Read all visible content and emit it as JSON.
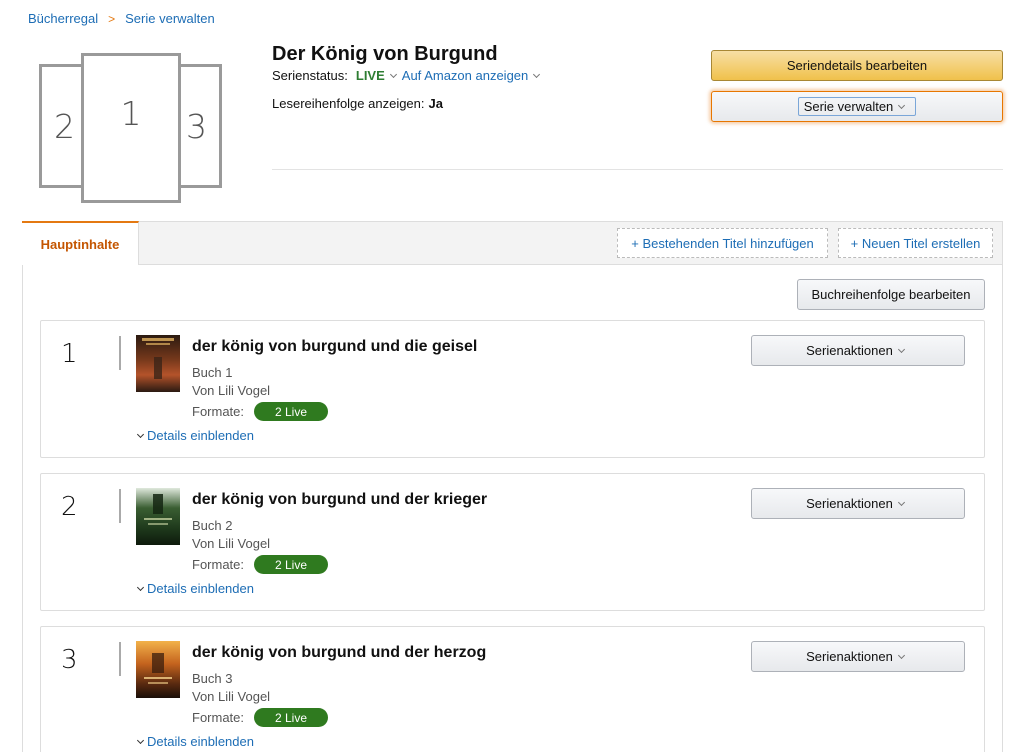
{
  "breadcrumb": {
    "items": [
      "Bücherregal",
      "Serie verwalten"
    ],
    "separator": ">"
  },
  "cover_placeholder": {
    "left": "2",
    "center": "1",
    "right": "3"
  },
  "series": {
    "title": "Der König von Burgund",
    "status_label": "Serienstatus:",
    "status_value": "LIVE",
    "amazon_link": "Auf Amazon anzeigen",
    "reading_order_label": "Lesereihenfolge anzeigen:",
    "reading_order_value": "Ja"
  },
  "actions": {
    "edit_details": "Seriendetails bearbeiten",
    "manage_series": "Serie verwalten"
  },
  "tabs": {
    "active": "Hauptinhalte",
    "add_existing": "+ Bestehenden Titel hinzufügen",
    "create_new": "+ Neuen Titel erstellen"
  },
  "reorder_button": "Buchreihenfolge bearbeiten",
  "books": [
    {
      "number": "1",
      "title": "der könig von burgund und die geisel",
      "book": "Buch 1",
      "author": "Von Lili Vogel",
      "formats_label": "Formate:",
      "formats_value": "2 Live",
      "details": "Details einblenden",
      "actions": "Serienaktionen"
    },
    {
      "number": "2",
      "title": "der könig von burgund und der krieger",
      "book": "Buch 2",
      "author": "Von Lili Vogel",
      "formats_label": "Formate:",
      "formats_value": "2 Live",
      "details": "Details einblenden",
      "actions": "Serienaktionen"
    },
    {
      "number": "3",
      "title": "der könig von burgund und der herzog",
      "book": "Buch 3",
      "author": "Von Lili Vogel",
      "formats_label": "Formate:",
      "formats_value": "2 Live",
      "details": "Details einblenden",
      "actions": "Serienaktionen"
    }
  ],
  "colors": {
    "accent": "#e47911",
    "link": "#1d6db5",
    "live": "#2e7d32",
    "pill": "#2f7a1f",
    "primary_button": "#f0c14b"
  }
}
